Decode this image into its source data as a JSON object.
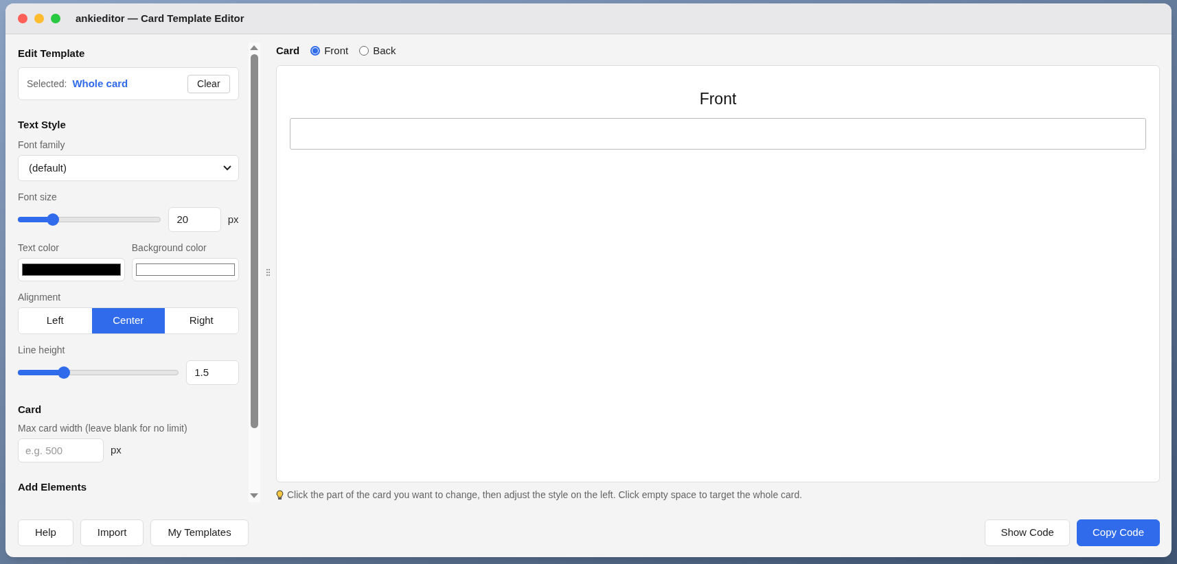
{
  "window": {
    "title": "ankieditor — Card Template Editor"
  },
  "sidebar": {
    "title": "Edit Template",
    "selection": {
      "label": "Selected:",
      "value": "Whole card",
      "button": "Clear"
    },
    "text_style": {
      "title": "Text Style",
      "font_family": {
        "label": "Font family",
        "value": "(default)"
      },
      "font_size": {
        "label": "Font size",
        "level": 0.22,
        "value": "20",
        "unit": "px"
      },
      "colors": [
        {
          "label": "Text color",
          "color": "#000000"
        },
        {
          "label": "Background color",
          "color": "#ffffff"
        }
      ],
      "alignment": {
        "label": "Alignment",
        "options": [
          {
            "label": "Left",
            "selected": false
          },
          {
            "label": "Center",
            "selected": true
          },
          {
            "label": "Right",
            "selected": false
          }
        ]
      },
      "line_height": {
        "label": "Line height",
        "level": 0.27,
        "value": "1.5"
      }
    },
    "card": {
      "title": "Card",
      "max_width": {
        "label": "Max card width (leave blank for no limit)",
        "placeholder": "e.g. 500",
        "unit": "px"
      }
    },
    "add_elements": {
      "title": "Add Elements"
    }
  },
  "preview": {
    "label": "Card",
    "sides": [
      {
        "label": "Front",
        "selected": true
      },
      {
        "label": "Back",
        "selected": false
      }
    ],
    "heading": "Front",
    "hint": "Click the part of the card you want to change, then adjust the style on the left. Click empty space to target the whole card."
  },
  "footer": {
    "left_buttons": [
      "Help",
      "Import",
      "My Templates"
    ],
    "right_buttons": [
      {
        "label": "Show Code",
        "kind": "secondary"
      },
      {
        "label": "Copy Code",
        "kind": "primary"
      }
    ]
  }
}
